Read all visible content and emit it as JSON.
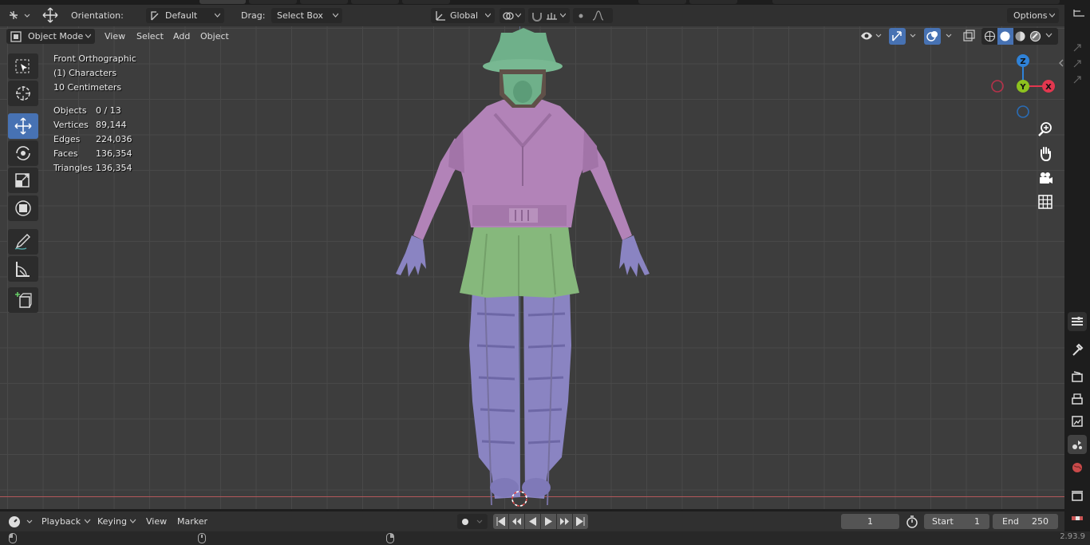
{
  "header": {
    "orientation_label": "Orientation:",
    "orientation_value": "Default",
    "drag_label": "Drag:",
    "drag_value": "Select Box",
    "transform_orientation": "Global",
    "options_label": "Options"
  },
  "viewport_header": {
    "mode": "Object Mode",
    "menus": [
      "View",
      "Select",
      "Add",
      "Object"
    ]
  },
  "tools": [
    "select-box-tool",
    "cursor-tool",
    "move-tool",
    "rotate-tool",
    "scale-tool",
    "transform-tool",
    "annotate-tool",
    "measure-tool",
    "add-cube-tool"
  ],
  "active_tool": "move-tool",
  "overlay": {
    "view_name": "Front Orthographic",
    "collection": "(1) Characters",
    "scale": "10 Centimeters",
    "stats": [
      {
        "label": "Objects",
        "value": "0 / 13"
      },
      {
        "label": "Vertices",
        "value": "89,144"
      },
      {
        "label": "Edges",
        "value": "224,036"
      },
      {
        "label": "Faces",
        "value": "136,354"
      },
      {
        "label": "Triangles",
        "value": "136,354"
      }
    ]
  },
  "gizmo": {
    "x_label": "X",
    "y_label": "Y",
    "z_label": "Z"
  },
  "timeline": {
    "menus": [
      "Playback",
      "Keying",
      "View",
      "Marker"
    ],
    "current_frame": "1",
    "start_label": "Start",
    "start_value": "1",
    "end_label": "End",
    "end_value": "250"
  },
  "status": {
    "version": "2.93.9"
  },
  "colors": {
    "accent": "#4772b3",
    "x_axis": "#e2374f",
    "y_axis": "#8dc21f",
    "z_axis": "#2f82d8",
    "helmet": "#6fb08a",
    "jacket": "#b283b8",
    "skirt": "#86b87c",
    "pants": "#8a84c2"
  }
}
